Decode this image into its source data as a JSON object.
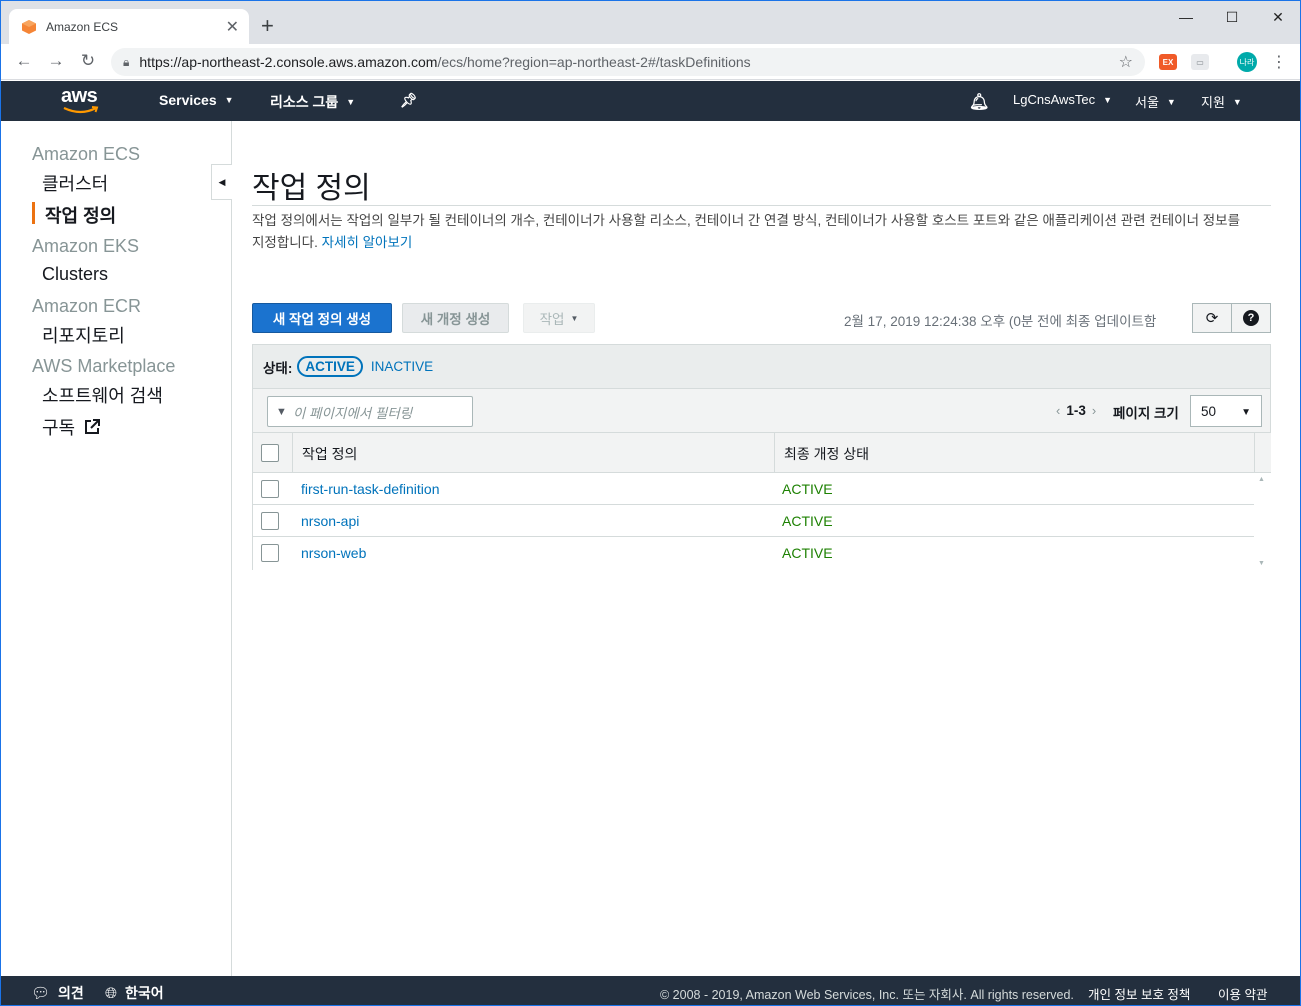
{
  "browser": {
    "tab_title": "Amazon ECS",
    "tab_close": "✕",
    "new_tab": "+",
    "url_host": "https://ap-northeast-2.console.aws.amazon.com",
    "url_path": "/ecs/home?region=ap-northeast-2#/taskDefinitions",
    "profile_initial": "나라",
    "ext_label": "EX"
  },
  "awsnav": {
    "logo_text": "aws",
    "services": "Services",
    "resource_groups": "리소스 그룹",
    "account": "LgCnsAwsTec",
    "region": "서울",
    "support": "지원"
  },
  "sidebar": {
    "groups": [
      {
        "label": "Amazon ECS",
        "items": [
          "클러스터",
          "작업 정의"
        ]
      },
      {
        "label": "Amazon EKS",
        "items": [
          "Clusters"
        ]
      },
      {
        "label": "Amazon ECR",
        "items": [
          "리포지토리"
        ]
      },
      {
        "label": "AWS Marketplace",
        "items": [
          "소프트웨어 검색",
          "구독"
        ]
      }
    ]
  },
  "main": {
    "title": "작업 정의",
    "description": "작업 정의에서는 작업의 일부가 될 컨테이너의 개수, 컨테이너가 사용할 리소스, 컨테이너 간 연결 방식, 컨테이너가 사용할 호스트 포트와 같은 애플리케이션 관련 컨테이너 정보를 지정합니다.",
    "learn_more": "자세히 알아보기",
    "create_button": "새 작업 정의 생성",
    "new_revision_button": "새 개정 생성",
    "actions_button": "작업",
    "last_updated": "2월 17, 2019 12:24:38 오후 (0분 전에 최종 업데이트함",
    "status_label": "상태:",
    "status_active": "ACTIVE",
    "status_inactive": "INACTIVE",
    "filter_placeholder": "이 페이지에서 필터링",
    "page_range": "1-3",
    "page_size_label": "페이지 크기",
    "page_size_value": "50",
    "columns": [
      "작업 정의",
      "최종 개정 상태"
    ],
    "rows": [
      {
        "name": "first-run-task-definition",
        "status": "ACTIVE"
      },
      {
        "name": "nrson-api",
        "status": "ACTIVE"
      },
      {
        "name": "nrson-web",
        "status": "ACTIVE"
      }
    ]
  },
  "footer": {
    "feedback": "의견",
    "language": "한국어",
    "copyright": "© 2008 - 2019, Amazon Web Services, Inc. 또는 자회사. All rights reserved.",
    "privacy": "개인 정보 보호 정책",
    "terms": "이용 약관"
  },
  "colors": {
    "aws_nav": "#232f3e",
    "primary": "#1b73cf",
    "link": "#0073bb",
    "active_status": "#1d8102",
    "sidebar_marker": "#ec7211"
  }
}
